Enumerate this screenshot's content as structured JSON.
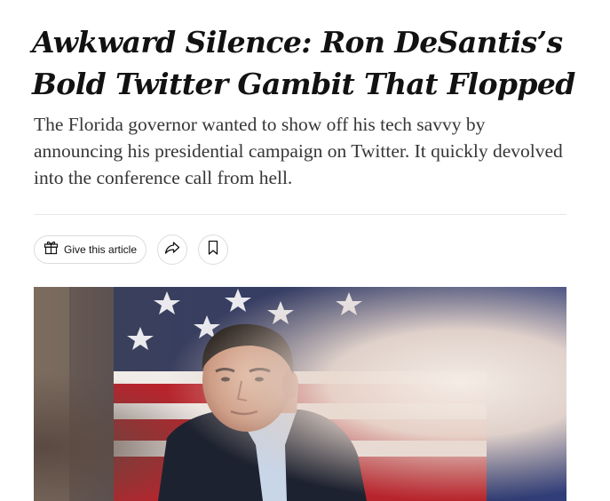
{
  "article": {
    "headline": "Awkward Silence: Ron DeSantis’s Bold Twitter Gambit That Flopped",
    "summary": "The Florida governor wanted to show off his tech savvy by announcing his presidential campaign on Twitter. It quickly devolved into the conference call from hell."
  },
  "toolbar": {
    "gift_label": "Give this article",
    "gift_icon": "gift-icon",
    "share_icon": "share-arrow-icon",
    "save_icon": "bookmark-icon"
  },
  "photo": {
    "subject": "Ron DeSantis in front of American flag"
  },
  "colors": {
    "text": "#121212",
    "summary_text": "#363636",
    "flag_blue": "#243a7a",
    "flag_red": "#b8242c"
  }
}
